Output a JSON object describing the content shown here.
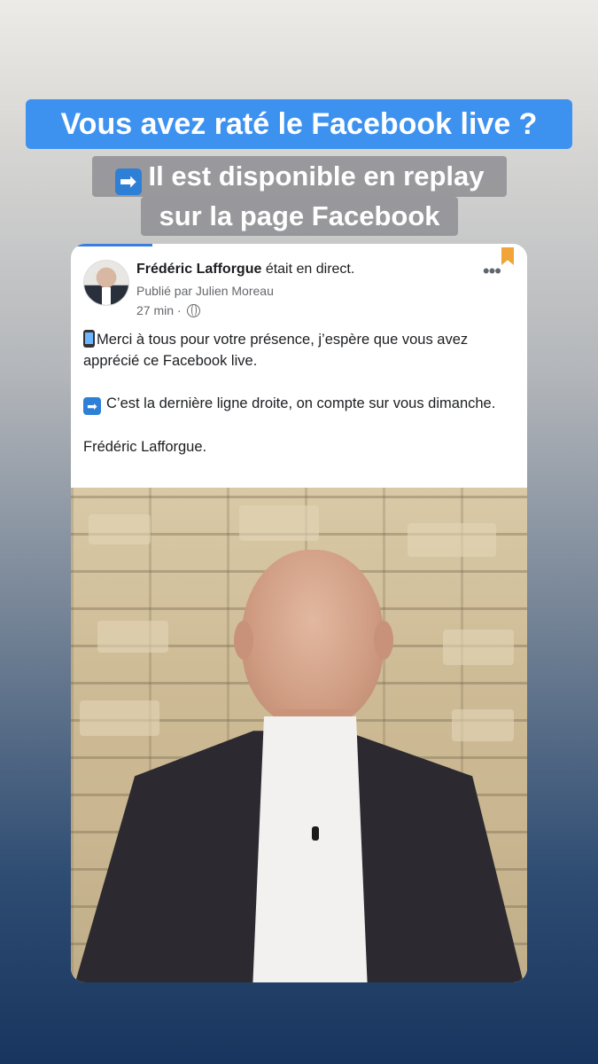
{
  "headline": "Vous avez raté le Facebook live ?",
  "subheadline": {
    "arrow": "➡",
    "line1": "Il est disponible en replay",
    "line2": "sur la page Facebook"
  },
  "post": {
    "author": "Frédéric Lafforgue",
    "status": "était en direct.",
    "published_by": "Publié par Julien Moreau",
    "time": "27 min",
    "more_label": "•••",
    "paragraph1": "Merci à tous pour votre présence, j’espère que vous avez apprécié ce Facebook live.",
    "paragraph2": "C’est la dernière ligne droite, on compte sur vous dimanche.",
    "signature": "Frédéric Lafforgue.",
    "arrow2": "➡"
  },
  "colors": {
    "headline_bg": "#3d92f0",
    "bookmark": "#f1a43a",
    "accent": "#3b7de0"
  },
  "icons": [
    "phone-emoji-icon",
    "arrow-right-icon",
    "globe-icon",
    "more-icon",
    "bookmark-icon"
  ]
}
